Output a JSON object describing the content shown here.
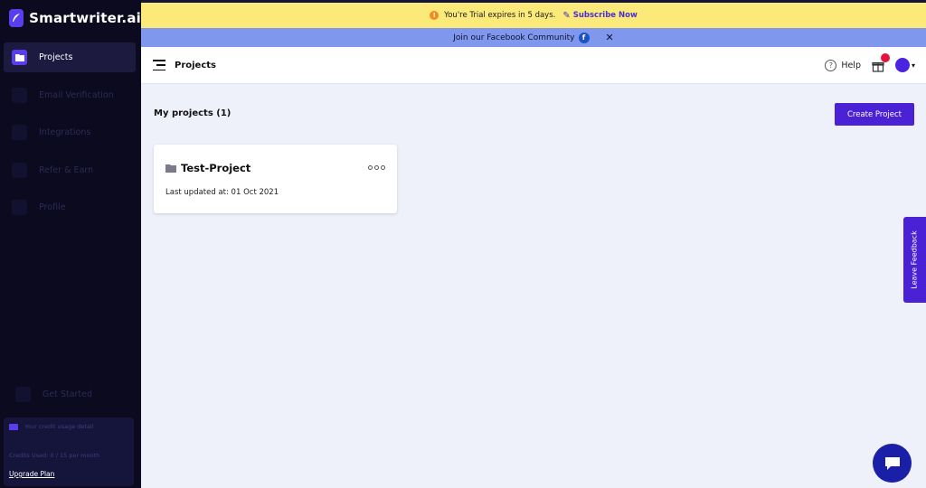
{
  "brand": {
    "name": "Smartwriter.ai"
  },
  "sidebar": {
    "items": [
      {
        "label": "Projects",
        "icon": "folder-icon",
        "active": true
      },
      {
        "label": "Email Verification",
        "icon": "mail-icon",
        "active": false
      },
      {
        "label": "Integrations",
        "icon": "plug-icon",
        "active": false
      },
      {
        "label": "Refer & Earn",
        "icon": "gift-icon",
        "active": false
      },
      {
        "label": "Profile",
        "icon": "user-icon",
        "active": false
      }
    ],
    "get_started": "Get Started",
    "credit": {
      "heading": "Your credit usage detail",
      "used": "Credits Used: 0 / 15 per month",
      "upgrade": "Upgrade Plan"
    }
  },
  "trial_banner": {
    "message": "You're Trial expires in 5 days.",
    "cta": "Subscribe Now"
  },
  "community_banner": {
    "message": "Join our Facebook Community",
    "close": "✕"
  },
  "header": {
    "title": "Projects",
    "help": "Help"
  },
  "main": {
    "section_title": "My projects (1)",
    "create_button": "Create Project",
    "projects": [
      {
        "name": "Test-Project",
        "updated": "Last updated at: 01 Oct 2021"
      }
    ]
  },
  "feedback": {
    "label": "Leave Feedback"
  },
  "colors": {
    "sidebar_bg": "#0b0a1e",
    "accent": "#4b21d6",
    "trial_bg": "#fbe97a",
    "community_bg": "#7f97ec",
    "content_bg": "#eef0fa"
  }
}
